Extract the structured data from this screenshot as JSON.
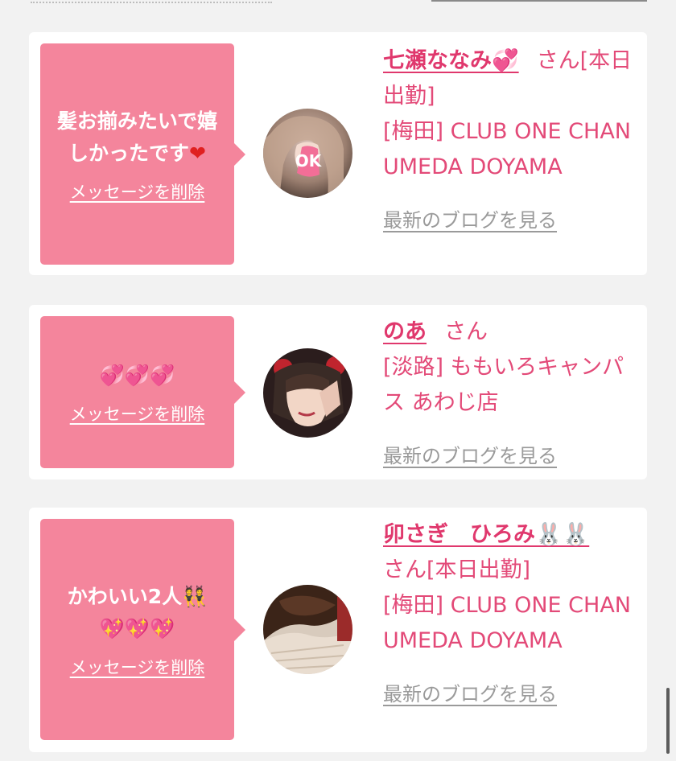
{
  "cards": [
    {
      "message": "髪お揃みたいで嬉しかったです❤️",
      "message_text": "髪お揃みたいで嬉しかったです",
      "message_emoji": "❤",
      "delete_label": "メッセージを削除",
      "name": "七瀬ななみ💞",
      "name_text": "七瀬ななみ",
      "name_emoji": "💞",
      "honorific": "さん[本日出勤]",
      "store": "[梅田] CLUB ONE CHAN UMEDA DOYAMA",
      "blog_label": "最新のブログを見る"
    },
    {
      "message": "💞💞💞",
      "delete_label": "メッセージを削除",
      "name": "のあ",
      "honorific": "さん",
      "store": "[淡路] ももいろキャンパス あわじ店",
      "blog_label": "最新のブログを見る"
    },
    {
      "message_line1": "かわいい2人👯",
      "message_line1_text": "かわいい2人",
      "message_line1_emoji": "👯",
      "message_line2": "💖💖💖",
      "delete_label": "メッセージを削除",
      "name": "卯さぎ　ひろみ🐰🐰",
      "name_text": "卯さぎ　ひろみ",
      "name_emoji": "🐰🐰",
      "honorific": "さん[本日出勤]",
      "store": "[梅田] CLUB ONE CHAN UMEDA DOYAMA",
      "blog_label": "最新のブログを見る"
    }
  ],
  "colors": {
    "bubble": "#f4859c",
    "accent_text": "#e34a78",
    "link_gray": "#9a9a9a",
    "background": "#f2f2f2"
  }
}
